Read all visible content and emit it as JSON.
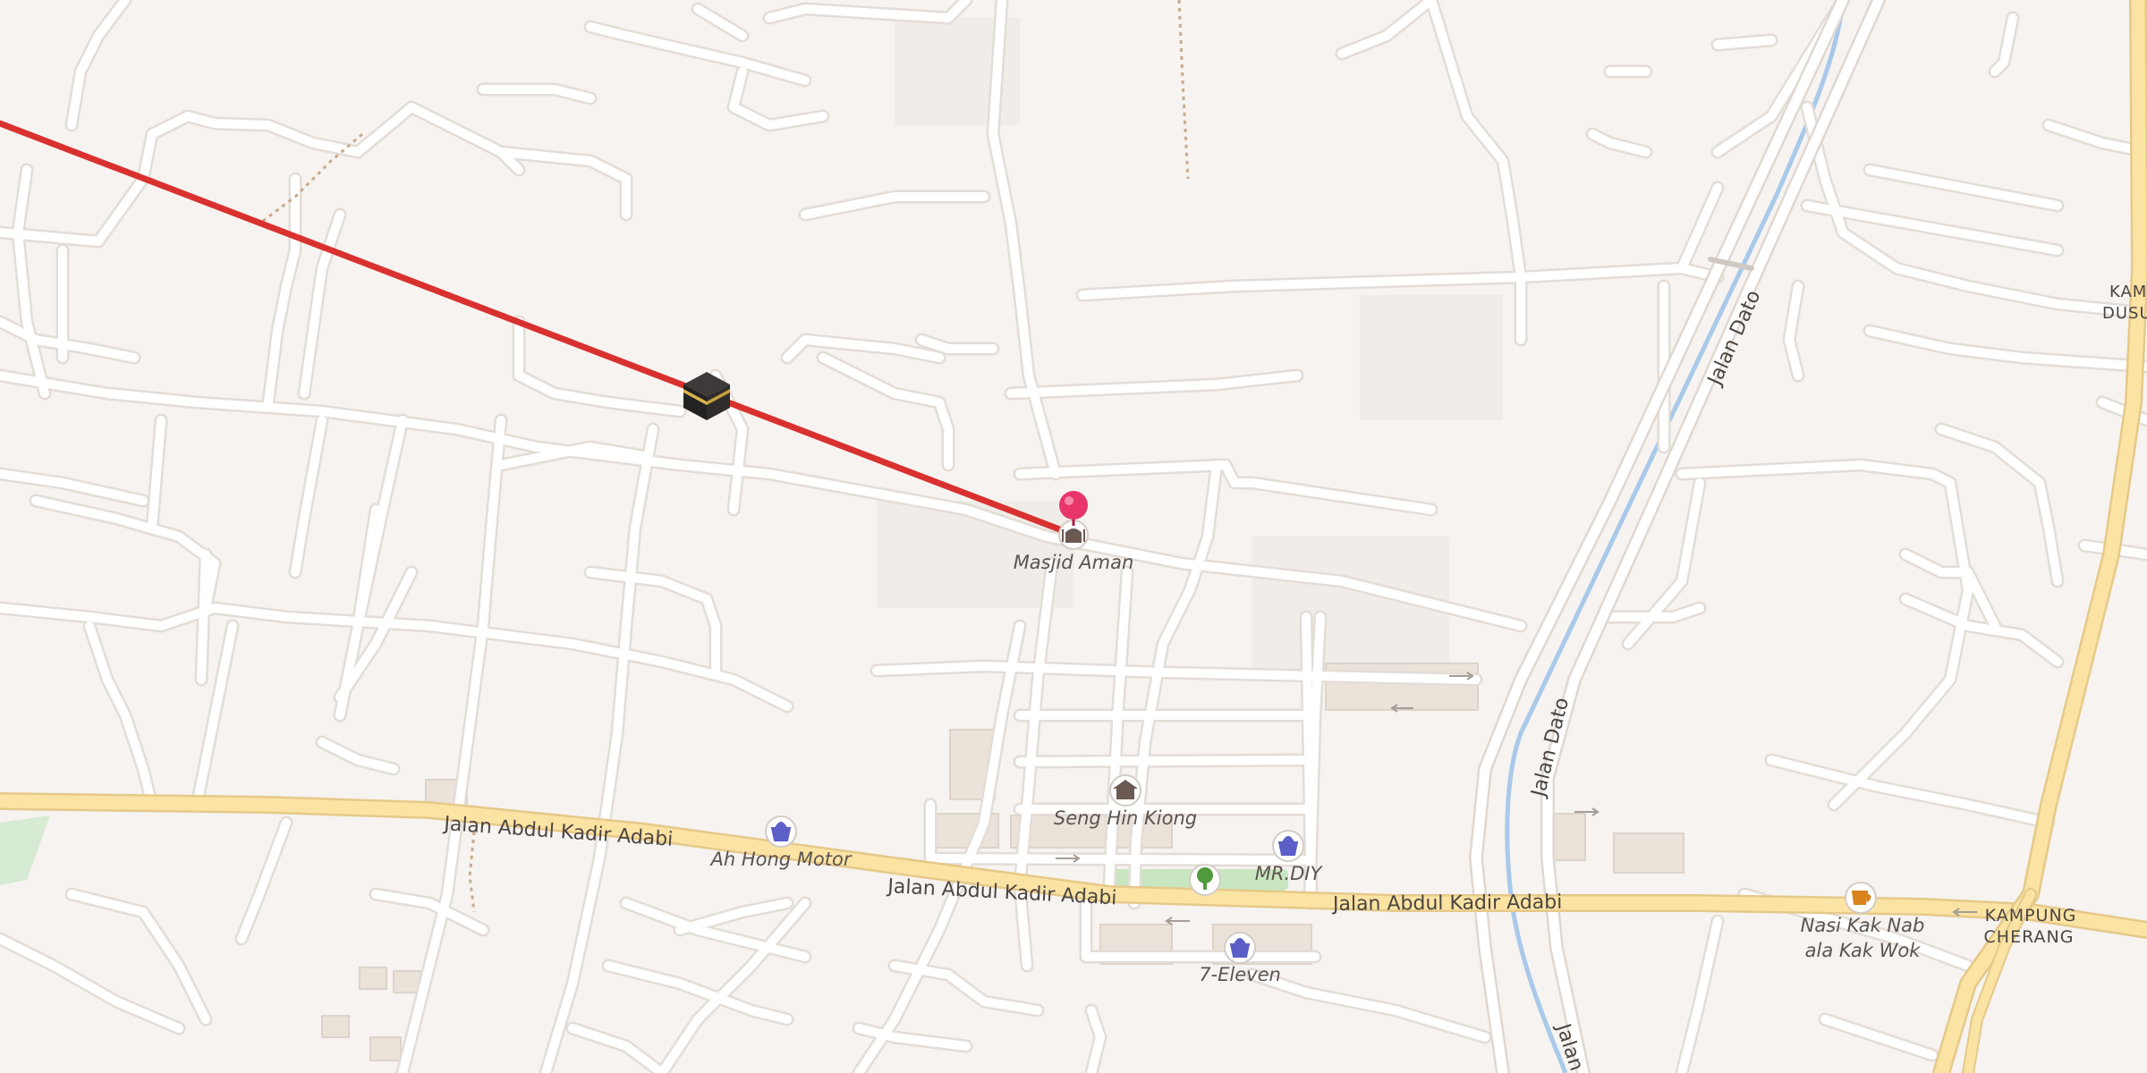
{
  "map": {
    "roads": {
      "main_1": "Jalan Abdul Kadir Adabi",
      "main_2": "Jalan Abdul Kadir Adabi",
      "main_3": "Jalan Abdul Kadir Adabi",
      "side_1": "Jalan Dato",
      "side_2": "Jalan Dato",
      "side_3": "Jalan"
    },
    "areas": {
      "kampung_cherang_1": "KAMPUNG",
      "kampung_cherang_2": "CHERANG",
      "kampung_dusun_1": "KAM",
      "kampung_dusun_2": "DUSU"
    },
    "pois": {
      "masjid_aman": "Masjid Aman",
      "seng_hin_kiong": "Seng Hin Kiong",
      "ah_hong_motor": "Ah Hong Motor",
      "mr_diy": "MR.DIY",
      "seven_eleven": "7-Eleven",
      "nasi_kak_nab_1": "Nasi Kak Nab",
      "nasi_kak_nab_2": "ala Kak Wok"
    },
    "colors": {
      "background": "#f6f3f0",
      "road": "#ffffff",
      "main_road": "#fbe3a4",
      "qibla_line": "#d8312f",
      "pin": "#e8356a",
      "river": "#a9c9ea",
      "poi_shop": "#5b5fc7",
      "poi_cafe": "#d8831c",
      "poi_worship": "#6a5a52",
      "park": "#c8e6c0"
    }
  }
}
